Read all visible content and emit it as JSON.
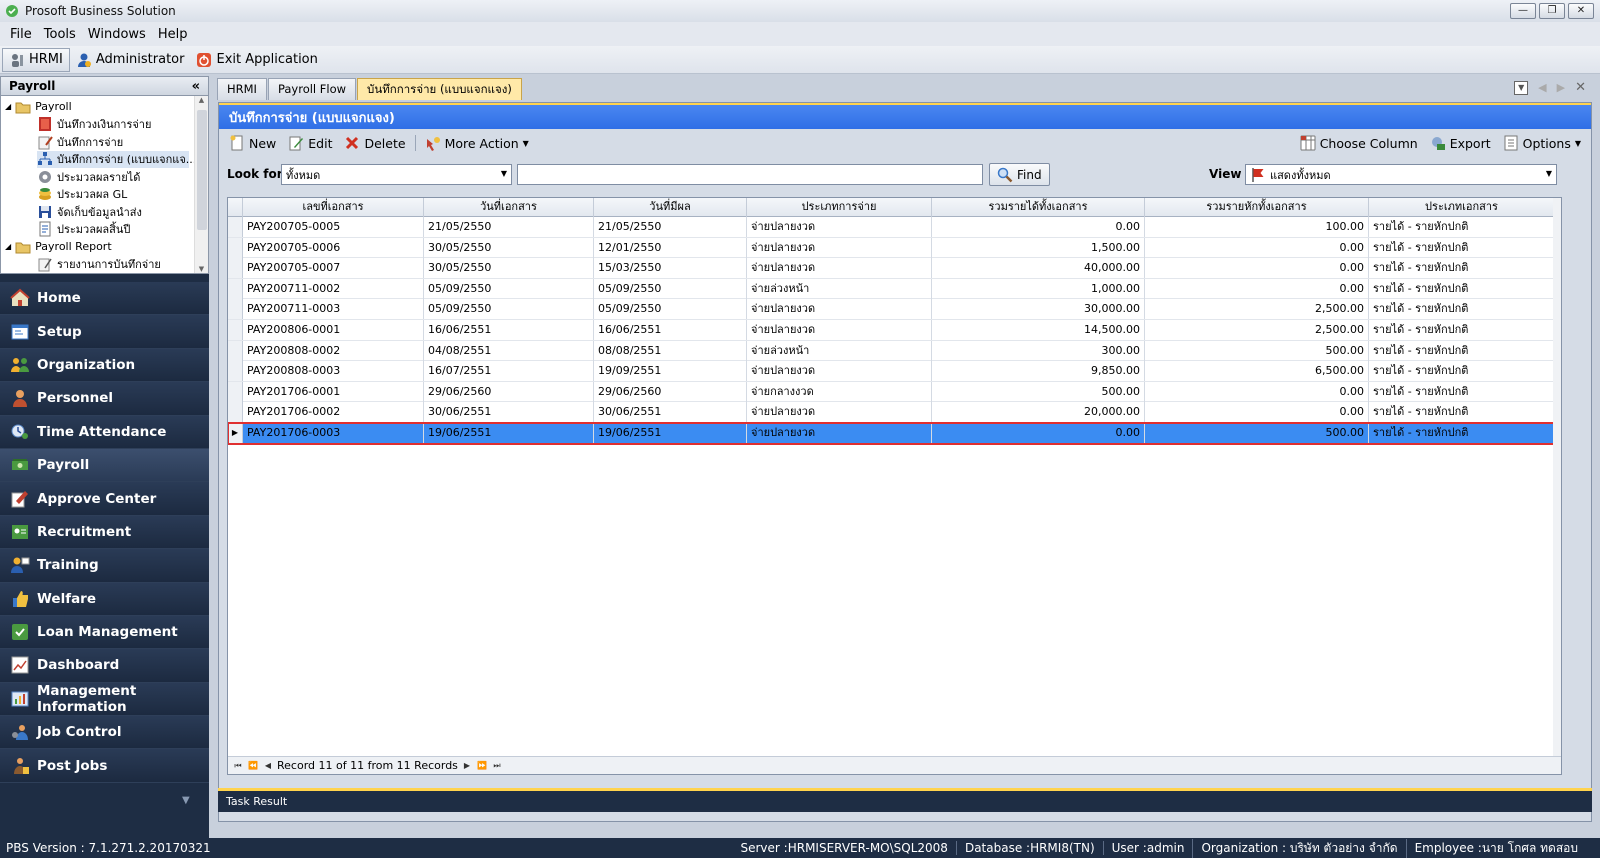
{
  "window": {
    "title": "Prosoft Business Solution"
  },
  "menu": [
    "File",
    "Tools",
    "Windows",
    "Help"
  ],
  "modules": {
    "hrmi": "HRMI",
    "admin": "Administrator",
    "exit": "Exit Application"
  },
  "leftpanel": {
    "title": "Payroll",
    "tree": [
      {
        "label": "Payroll",
        "level": 0,
        "expanded": true
      },
      {
        "label": "บันทึกวงเงินการจ่าย",
        "level": 1
      },
      {
        "label": "บันทึกการจ่าย",
        "level": 1
      },
      {
        "label": "บันทึกการจ่าย (แบบแจกแจ...",
        "level": 1,
        "selected": true
      },
      {
        "label": "ประมวลผลรายได้",
        "level": 1
      },
      {
        "label": "ประมวลผล GL",
        "level": 1
      },
      {
        "label": "จัดเก็บข้อมูลนำส่ง",
        "level": 1
      },
      {
        "label": "ประมวลผลสิ้นปี",
        "level": 1
      },
      {
        "label": "Payroll Report",
        "level": 0,
        "expanded": true
      },
      {
        "label": "รายงานการบันทึกจ่าย",
        "level": 1
      }
    ],
    "nav": [
      "Home",
      "Setup",
      "Organization",
      "Personnel",
      "Time Attendance",
      "Payroll",
      "Approve Center",
      "Recruitment",
      "Training",
      "Welfare",
      "Loan Management",
      "Dashboard",
      "Management Information",
      "Job Control",
      "Post Jobs"
    ],
    "active_nav": "Payroll"
  },
  "tabs": [
    "HRMI",
    "Payroll Flow",
    "บันทึกการจ่าย (แบบแจกแจง)"
  ],
  "active_tab": 2,
  "panel": {
    "caption": "บันทึกการจ่าย (แบบแจกแจง)",
    "toolbar": {
      "new": "New",
      "edit": "Edit",
      "delete": "Delete",
      "more": "More Action",
      "choose_column": "Choose Column",
      "export": "Export",
      "options": "Options"
    },
    "search": {
      "look_for_label": "Look for",
      "look_for_value": "ทั้งหมด",
      "search_text": "",
      "find": "Find",
      "view_label": "View",
      "view_value": "แสดงทั้งหมด"
    }
  },
  "grid": {
    "columns": [
      "เลขที่เอกสาร",
      "วันที่เอกสาร",
      "วันที่มีผล",
      "ประเภทการจ่าย",
      "รวมรายได้ทั้งเอกสาร",
      "รวมรายหักทั้งเอกสาร",
      "ประเภทเอกสาร"
    ],
    "rows": [
      [
        "PAY200705-0005",
        "21/05/2550",
        "21/05/2550",
        "จ่ายปลายงวด",
        "0.00",
        "100.00",
        "รายได้ - รายหักปกติ"
      ],
      [
        "PAY200705-0006",
        "30/05/2550",
        "12/01/2550",
        "จ่ายปลายงวด",
        "1,500.00",
        "0.00",
        "รายได้ - รายหักปกติ"
      ],
      [
        "PAY200705-0007",
        "30/05/2550",
        "15/03/2550",
        "จ่ายปลายงวด",
        "40,000.00",
        "0.00",
        "รายได้ - รายหักปกติ"
      ],
      [
        "PAY200711-0002",
        "05/09/2550",
        "05/09/2550",
        "จ่ายล่วงหน้า",
        "1,000.00",
        "0.00",
        "รายได้ - รายหักปกติ"
      ],
      [
        "PAY200711-0003",
        "05/09/2550",
        "05/09/2550",
        "จ่ายปลายงวด",
        "30,000.00",
        "2,500.00",
        "รายได้ - รายหักปกติ"
      ],
      [
        "PAY200806-0001",
        "16/06/2551",
        "16/06/2551",
        "จ่ายปลายงวด",
        "14,500.00",
        "2,500.00",
        "รายได้ - รายหักปกติ"
      ],
      [
        "PAY200808-0002",
        "04/08/2551",
        "08/08/2551",
        "จ่ายล่วงหน้า",
        "300.00",
        "500.00",
        "รายได้ - รายหักปกติ"
      ],
      [
        "PAY200808-0003",
        "16/07/2551",
        "19/09/2551",
        "จ่ายปลายงวด",
        "9,850.00",
        "6,500.00",
        "รายได้ - รายหักปกติ"
      ],
      [
        "PAY201706-0001",
        "29/06/2560",
        "29/06/2560",
        "จ่ายกลางงวด",
        "500.00",
        "0.00",
        "รายได้ - รายหักปกติ"
      ],
      [
        "PAY201706-0002",
        "30/06/2551",
        "30/06/2551",
        "จ่ายปลายงวด",
        "20,000.00",
        "0.00",
        "รายได้ - รายหักปกติ"
      ],
      [
        "PAY201706-0003",
        "19/06/2551",
        "19/06/2551",
        "จ่ายปลายงวด",
        "0.00",
        "500.00",
        "รายได้ - รายหักปกติ"
      ]
    ],
    "selected_row": 10,
    "record_text": "Record 11 of 11 from 11 Records"
  },
  "task_result": "Task Result",
  "status": {
    "version": "PBS Version : 7.1.271.2.20170321",
    "server": "Server :HRMISERVER-MO\\SQL2008",
    "database": "Database :HRMI8(TN)",
    "user": "User :admin",
    "organization": "Organization : บริษัท ตัวอย่าง จำกัด",
    "employee": "Employee :นาย โกศล ทดสอบ"
  },
  "colors": {
    "caption_blue": "#2f6fe6",
    "nav_dark": "#1e2d44",
    "selection_blue": "#3b8cf2",
    "selection_outline": "#e03030",
    "active_tab": "#ffe9a8"
  },
  "icons": {
    "app": "prosoft-logo-icon",
    "new": "new-document-icon",
    "edit": "edit-pencil-icon",
    "delete": "delete-x-icon",
    "find": "magnifier-icon",
    "view": "red-flag-icon"
  }
}
